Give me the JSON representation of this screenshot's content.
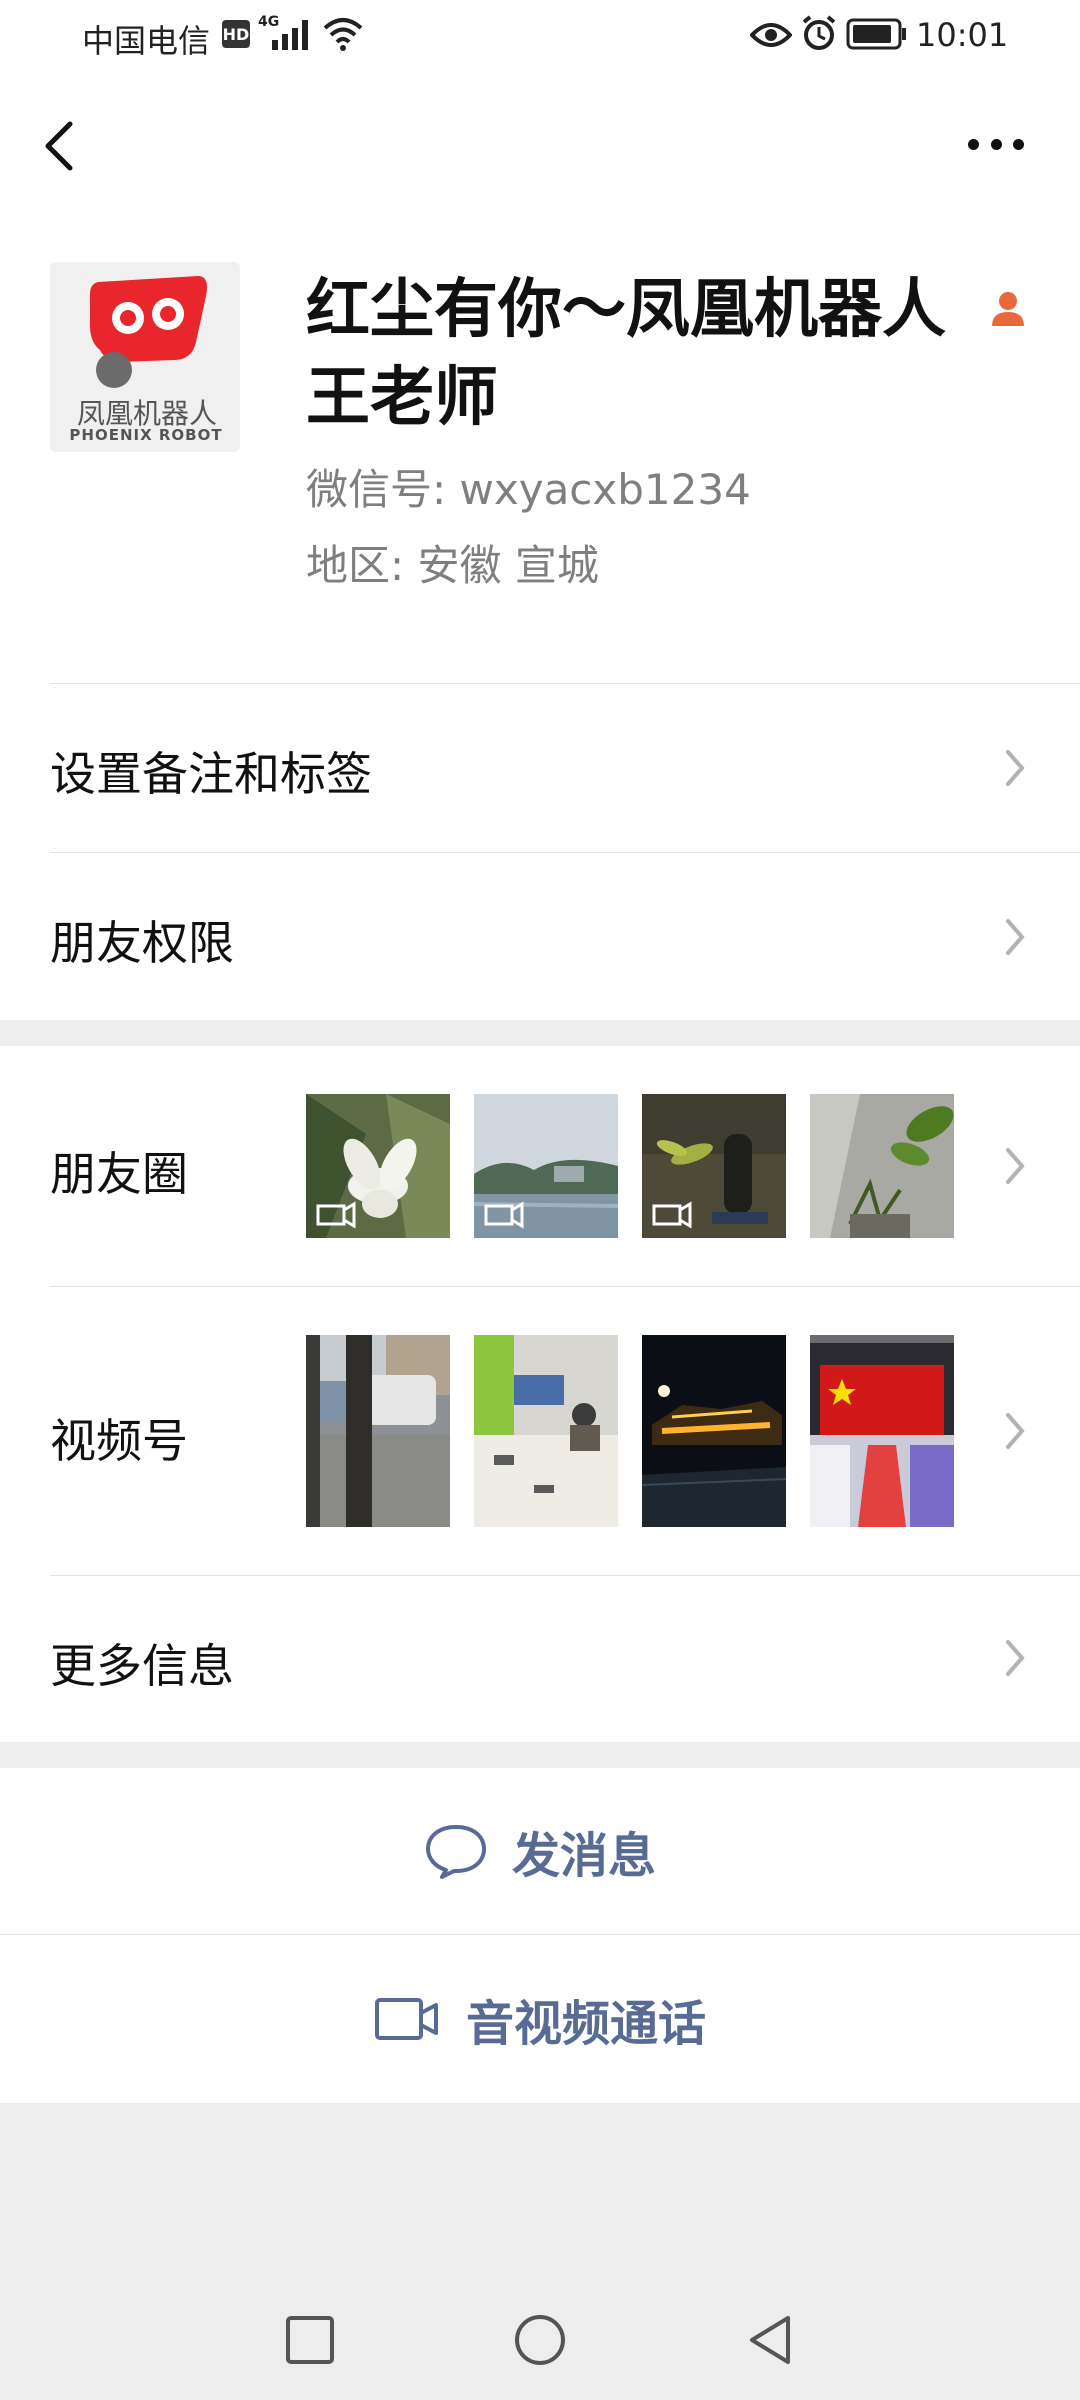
{
  "status_bar": {
    "carrier": "中国电信",
    "hd": "HD",
    "network": "4G",
    "time": "10:01"
  },
  "header": {
    "back_icon": "chevron-left-icon",
    "more_icon": "more-dots-icon"
  },
  "profile": {
    "name": "红尘有你～凤凰机器人王老师",
    "avatar_text_cn": "凤凰机器人",
    "avatar_text_en": "PHOENIX ROBOT",
    "wechat_id": "微信号: wxyacxb1234",
    "region": "地区: 安徽  宣城",
    "person_icon": "person-icon"
  },
  "menu": {
    "remarks": "设置备注和标签",
    "permissions": "朋友权限",
    "moments": "朋友圈",
    "channels": "视频号",
    "more_info": "更多信息"
  },
  "actions": {
    "message": "发消息",
    "call": "音视频通话"
  },
  "colors": {
    "accent": "#576b95",
    "avatar_red": "#e8262b",
    "person_icon": "#e86a3c",
    "background": "#ededed"
  }
}
